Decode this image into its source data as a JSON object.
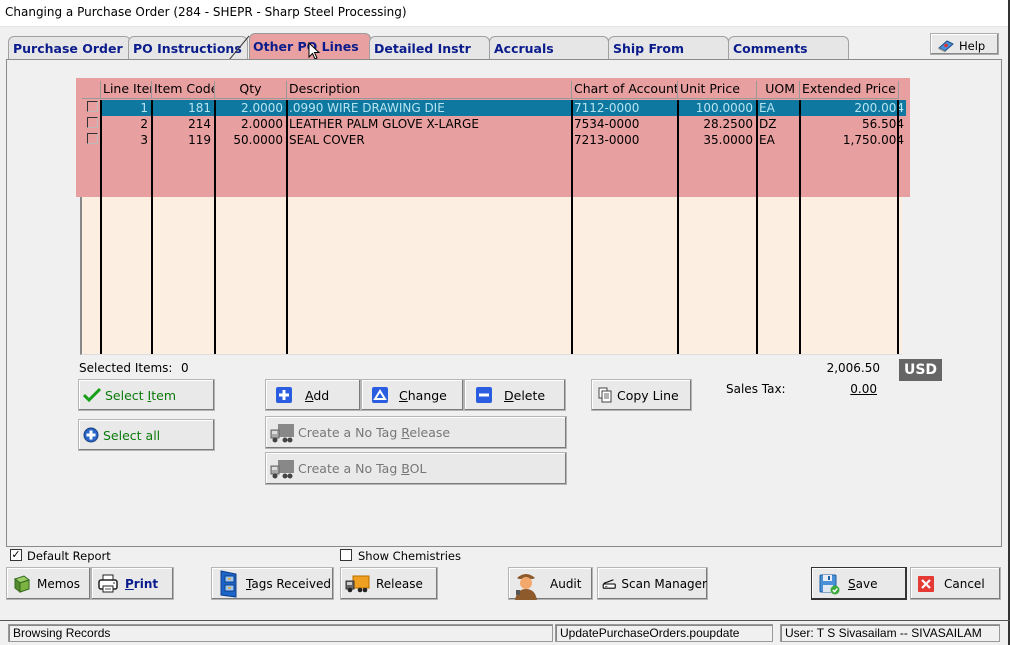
{
  "window": {
    "title": "Changing a Purchase Order  (284 - SHEPR - Sharp Steel Processing)"
  },
  "tabs": [
    {
      "label": "Purchase Order",
      "active": false
    },
    {
      "label": "PO Instructions",
      "active": false
    },
    {
      "label": "Other PO Lines",
      "active": true
    },
    {
      "label": "Detailed Instr",
      "active": false
    },
    {
      "label": "Accruals",
      "active": false
    },
    {
      "label": "Ship From",
      "active": false
    },
    {
      "label": "Comments",
      "active": false
    }
  ],
  "help": {
    "label": "Help",
    "icon": "help-book-icon"
  },
  "grid": {
    "columns": [
      "",
      "Line Item",
      "Item Code",
      "Qty",
      "Description",
      "Chart of Account",
      "Unit Price",
      "UOM",
      "Extended Price"
    ],
    "rows": [
      {
        "checked": false,
        "line": "1",
        "item_code": "181",
        "qty": "2.0000",
        "description": ".0990 WIRE DRAWING DIE",
        "account": "7112-0000",
        "unit_price": "100.0000",
        "uom": "EA",
        "extended": "200.004",
        "selected": true
      },
      {
        "checked": false,
        "line": "2",
        "item_code": "214",
        "qty": "2.0000",
        "description": "LEATHER PALM GLOVE X-LARGE",
        "account": "7534-0000",
        "unit_price": "28.2500",
        "uom": "DZ",
        "extended": "56.504",
        "selected": false
      },
      {
        "checked": false,
        "line": "3",
        "item_code": "119",
        "qty": "50.0000",
        "description": "SEAL COVER",
        "account": "7213-0000",
        "unit_price": "35.0000",
        "uom": "EA",
        "extended": "1,750.004",
        "selected": false
      }
    ]
  },
  "summary": {
    "selected_items_label": "Selected Items:",
    "selected_items_value": "0",
    "total": "2,006.50",
    "currency": "USD",
    "sales_tax_label": "Sales Tax:",
    "sales_tax_value": "0.00"
  },
  "actions": {
    "select_item": {
      "pre": "Select ",
      "ul": "I",
      "post": "tem",
      "icon": "checkmark-icon"
    },
    "select_all": {
      "label": "Select all",
      "icon": "plus-circle-icon"
    },
    "add": {
      "ul": "A",
      "post": "dd",
      "icon": "plus-square-icon"
    },
    "change": {
      "ul": "C",
      "post": "hange",
      "icon": "triangle-up-icon"
    },
    "delete": {
      "ul": "D",
      "post": "elete",
      "icon": "minus-square-icon"
    },
    "copy_line": {
      "label": "Copy Line",
      "icon": "copy-icon"
    },
    "no_tag_release": {
      "pre": "Create a No Tag ",
      "ul": "R",
      "post": "elease",
      "icon": "truck-icon"
    },
    "no_tag_bol": {
      "pre": "Create a No Tag ",
      "ul": "B",
      "post": "OL",
      "icon": "truck-icon"
    }
  },
  "options": {
    "default_report": {
      "label": "Default Report",
      "checked": true
    },
    "show_chemistries": {
      "label": "Show Chemistries",
      "checked": false
    }
  },
  "footer_buttons": {
    "memos": {
      "label": "Memos",
      "icon": "book-icon"
    },
    "print": {
      "ul": "P",
      "post": "rint",
      "icon": "printer-icon"
    },
    "tags_received": {
      "ul": "T",
      "post": "ags Received",
      "icon": "file-cabinet-icon"
    },
    "release": {
      "label": "Release",
      "icon": "truck-icon"
    },
    "audit": {
      "label": "Audit",
      "icon": "detective-icon"
    },
    "scan_manager": {
      "label": "Scan Manager",
      "icon": "scanner-icon"
    },
    "save": {
      "ul": "S",
      "post": "ave",
      "icon": "floppy-disk-icon"
    },
    "cancel": {
      "label": "Cancel",
      "icon": "close-icon"
    }
  },
  "statusbar": {
    "status": "Browsing Records",
    "module": "UpdatePurchaseOrders.poupdate",
    "user": "User: T S Sivasailam -- SIVASAILAM"
  }
}
